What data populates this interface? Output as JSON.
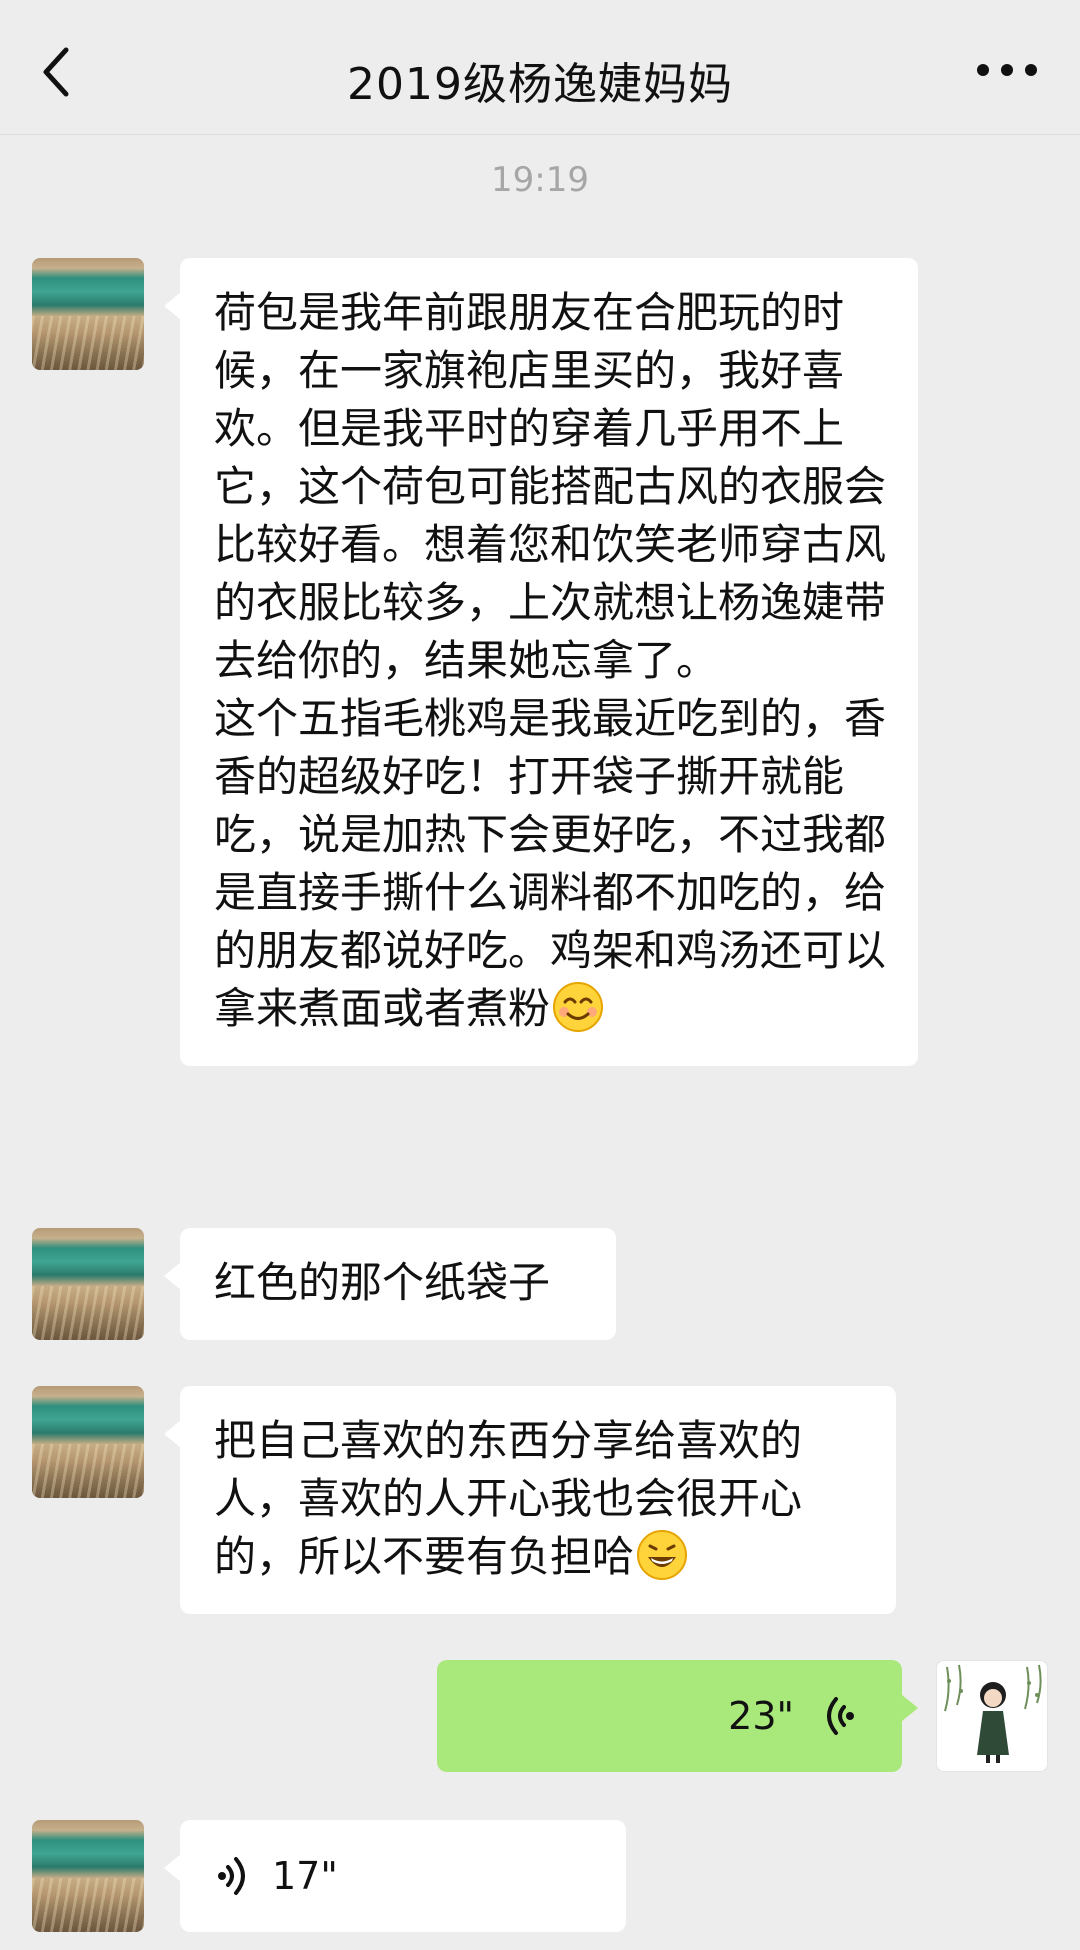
{
  "header": {
    "back_icon": "chevron-left-icon",
    "title": "2019级杨逸婕妈妈",
    "more_icon": "more-dots-icon"
  },
  "timestamp": "19:19",
  "messages": [
    {
      "side": "received",
      "type": "text",
      "text": "荷包是我年前跟朋友在合肥玩的时候，在一家旗袍店里买的，我好喜欢。但是我平时的穿着几乎用不上它，这个荷包可能搭配古风的衣服会比较好看。想着您和饮笑老师穿古风的衣服比较多，上次就想让杨逸婕带去给你的，结果她忘拿了。\n这个五指毛桃鸡是我最近吃到的，香香的超级好吃！打开袋子撕开就能吃，说是加热下会更好吃，不过我都是直接手撕什么调料都不加吃的，给的朋友都说好吃。鸡架和鸡汤还可以拿来煮面或者煮粉",
      "emoji": "smiling-face-emoji"
    },
    {
      "side": "received",
      "type": "text",
      "text": "红色的那个纸袋子"
    },
    {
      "side": "received",
      "type": "text",
      "text": "把自己喜欢的东西分享给喜欢的人，喜欢的人开心我也会很开心的，所以不要有负担哈",
      "emoji": "grinning-face-emoji"
    },
    {
      "side": "sent",
      "type": "voice",
      "duration": "23\"",
      "icon": "voice-wave-icon"
    },
    {
      "side": "received",
      "type": "voice",
      "duration": "17\"",
      "icon": "voice-wave-icon"
    }
  ],
  "colors": {
    "background": "#ededed",
    "received_bubble": "#ffffff",
    "sent_bubble": "#a9e97c",
    "timestamp": "#a6a6a6"
  }
}
